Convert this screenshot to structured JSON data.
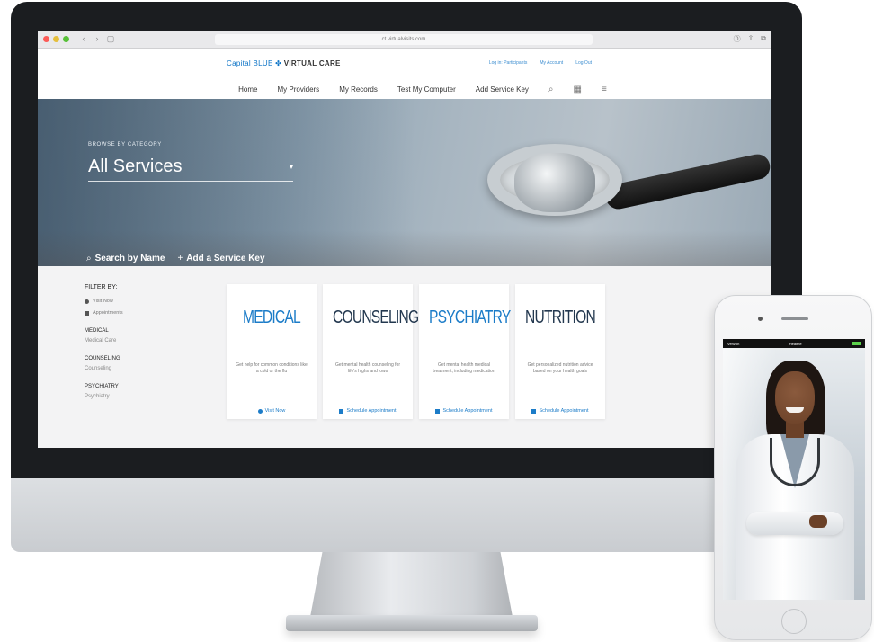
{
  "browser": {
    "url": "ct virtualvisits.com",
    "nav_back": "‹",
    "nav_forward": "›",
    "nav_sidebar": "▢",
    "reader_icon": "⓪",
    "share_icon": "⇧",
    "tabs_icon": "⧉"
  },
  "site": {
    "logo_brand": "Capital BLUE",
    "logo_product": "VIRTUAL CARE",
    "util_links": [
      "Log in: Participants",
      "My Account",
      "Log Out"
    ],
    "nav": [
      "Home",
      "My Providers",
      "My Records",
      "Test My Computer",
      "Add Service Key"
    ]
  },
  "hero": {
    "browse_label": "BROWSE BY CATEGORY",
    "category_value": "All Services",
    "search_label": "Search by Name",
    "add_key_label": "Add a Service Key"
  },
  "filters": {
    "title": "FILTER BY:",
    "options": [
      "Visit Now",
      "Appointments"
    ],
    "groups": [
      {
        "title": "MEDICAL",
        "item": "Medical Care"
      },
      {
        "title": "COUNSELING",
        "item": "Counseling"
      },
      {
        "title": "PSYCHIATRY",
        "item": "Psychiatry"
      }
    ]
  },
  "cards": [
    {
      "title": "MEDICAL",
      "desc": "Get help for common conditions like a cold or the flu",
      "cta": "Visit Now"
    },
    {
      "title": "COUNSELING",
      "desc": "Get mental health counseling for life's highs and lows",
      "cta": "Schedule Appointment"
    },
    {
      "title": "PSYCHIATRY",
      "desc": "Get mental health medical treatment, including medication",
      "cta": "Schedule Appointment"
    },
    {
      "title": "NUTRITION",
      "desc": "Get personalized nutrition advice based on your health goals",
      "cta": "Schedule Appointment"
    }
  ],
  "phone": {
    "carrier": "Verizon",
    "app_title": "Healthe"
  },
  "colors": {
    "accent": "#1c7cc8",
    "dark_title": "#23384f"
  }
}
